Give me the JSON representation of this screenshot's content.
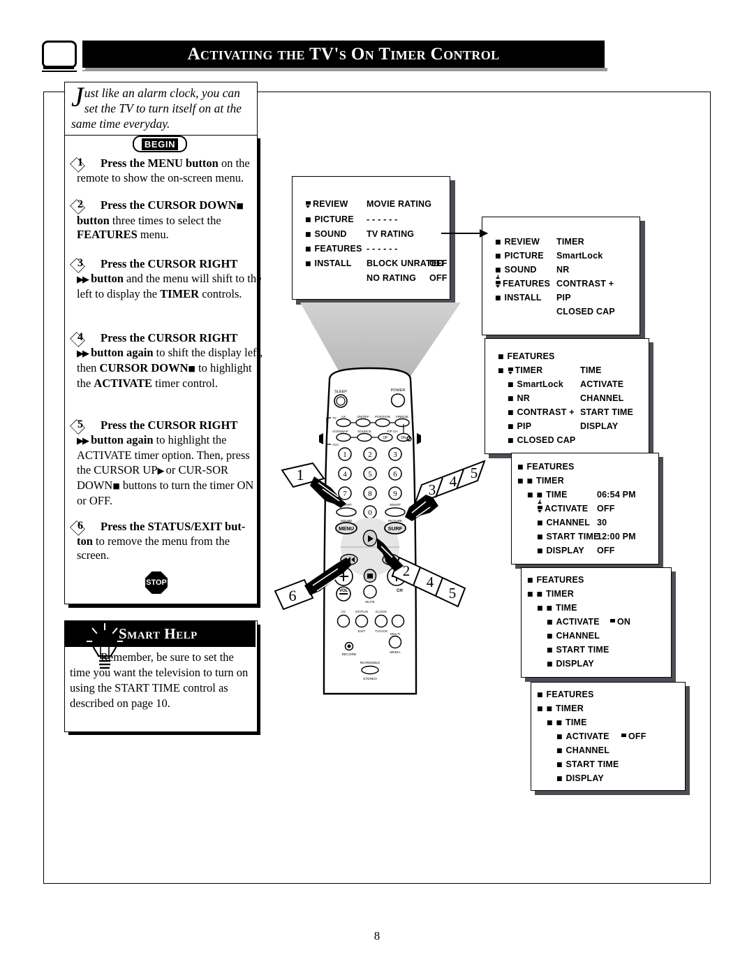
{
  "header": {
    "title": "Activating the TV's On Timer Control",
    "tv_icon": "tv-screen-icon"
  },
  "intro": {
    "dropcap": "J",
    "text": "ust like an alarm clock, you can set the TV to turn itself on at the same time everyday."
  },
  "begin_badge": "BEGIN",
  "stop_badge": "STOP",
  "steps": [
    {
      "number": "1",
      "line1_bold": "Press the MENU button",
      "line1_rest": " on the",
      "rest": "remote to show the on-screen menu."
    },
    {
      "number": "2",
      "line1_bold": "Press the CURSOR DOWN",
      "line1_rest": "",
      "rest_bold": "button",
      "rest": " three times to select the ",
      "rest_bold2": "FEATURES",
      "rest2": " menu."
    },
    {
      "number": "3",
      "line1_bold": "Press the CURSOR RIGHT",
      "rest_bold": "button",
      "rest": " and the menu will shift to the left to display the ",
      "rest_bold2": "TIMER",
      "rest2": " controls."
    },
    {
      "number": "4",
      "line1_bold": "Press the CURSOR RIGHT",
      "rest_bold": "button again",
      "rest": " to shift the display left, then ",
      "rest_bold2": "CURSOR DOWN",
      "rest2": " to highlight the ",
      "rest_bold3": "ACTIVATE",
      "rest3": " timer control."
    },
    {
      "number": "5",
      "line1_bold": "Press the CURSOR RIGHT",
      "rest_bold": "button again",
      "rest": " to highlight the ACTIVATE timer option. Then, press the CURSOR UP",
      "rest2": " or CUR-SOR DOWN",
      "rest3": " buttons to turn the timer ON or OFF."
    },
    {
      "number": "6",
      "line1_bold": "Press the STATUS/EXIT but-",
      "rest_bold": "ton",
      "rest": " to remove the menu from the screen."
    }
  ],
  "smart_help": {
    "title": "Smart Help",
    "icon": "lightbulb-icon",
    "text": "Remember, be sure to set the time you want the television to turn on using the START TIME control as described on page 10."
  },
  "osd_panels": [
    {
      "id": "panel-1-review",
      "left_column": [
        {
          "label": "REVIEW",
          "cursor": "down"
        },
        {
          "label": "PICTURE"
        },
        {
          "label": "SOUND"
        },
        {
          "label": "FEATURES"
        },
        {
          "label": "INSTALL"
        }
      ],
      "right_column": [
        {
          "label": "MOVIE RATING",
          "value": ""
        },
        {
          "label": "- - - - - -",
          "value": ""
        },
        {
          "label": "TV RATING",
          "value": ""
        },
        {
          "label": "- - - - - -",
          "value": ""
        },
        {
          "label": "BLOCK UNRATED",
          "value": "OFF"
        },
        {
          "label": "NO RATING",
          "value": "OFF"
        }
      ]
    },
    {
      "id": "panel-2-features",
      "left_column": [
        {
          "label": "REVIEW"
        },
        {
          "label": "PICTURE"
        },
        {
          "label": "SOUND"
        },
        {
          "label": "FEATURES",
          "cursor": "updown"
        },
        {
          "label": "INSTALL"
        }
      ],
      "right_column": [
        {
          "label": "TIMER"
        },
        {
          "label": "SmartLock"
        },
        {
          "label": "NR"
        },
        {
          "label": "CONTRAST +"
        },
        {
          "label": "PIP"
        },
        {
          "label": "CLOSED CAP"
        }
      ]
    },
    {
      "id": "panel-3-timer",
      "left_column": [
        {
          "label": "FEATURES",
          "indent": 0
        },
        {
          "label": "TIMER",
          "indent": 0,
          "double": true,
          "cursor": "down"
        },
        {
          "label": "SmartLock",
          "indent": 1
        },
        {
          "label": "NR",
          "indent": 1
        },
        {
          "label": "CONTRAST +",
          "indent": 1
        },
        {
          "label": "PIP",
          "indent": 1
        },
        {
          "label": "CLOSED CAP",
          "indent": 1
        }
      ],
      "right_column": [
        {
          "label": ""
        },
        {
          "label": "TIME"
        },
        {
          "label": "ACTIVATE"
        },
        {
          "label": "CHANNEL"
        },
        {
          "label": "START TIME"
        },
        {
          "label": "DISPLAY"
        }
      ]
    },
    {
      "id": "panel-4-activate-off",
      "rows": [
        {
          "label": "FEATURES",
          "indent": 0,
          "value": ""
        },
        {
          "label": "TIMER",
          "indent": 0,
          "double": true,
          "value": ""
        },
        {
          "label": "TIME",
          "indent": 1,
          "double": true,
          "value": "06:54 PM"
        },
        {
          "label": "ACTIVATE",
          "indent": 2,
          "cursor": "updown",
          "value": "OFF"
        },
        {
          "label": "CHANNEL",
          "indent": 2,
          "value": "30"
        },
        {
          "label": "START TIME",
          "indent": 2,
          "value": "12:00 PM"
        },
        {
          "label": "DISPLAY",
          "indent": 2,
          "value": "OFF"
        }
      ]
    },
    {
      "id": "panel-5-activate-on",
      "rows": [
        {
          "label": "FEATURES",
          "indent": 0,
          "value": ""
        },
        {
          "label": "TIMER",
          "indent": 0,
          "double": true,
          "value": ""
        },
        {
          "label": "TIME",
          "indent": 1,
          "double": true,
          "value": ""
        },
        {
          "label": "ACTIVATE",
          "indent": 2,
          "value": "ON",
          "value_cursor": true
        },
        {
          "label": "CHANNEL",
          "indent": 2,
          "value": ""
        },
        {
          "label": "START TIME",
          "indent": 2,
          "value": ""
        },
        {
          "label": "DISPLAY",
          "indent": 2,
          "value": ""
        }
      ]
    },
    {
      "id": "panel-6-activate-off2",
      "rows": [
        {
          "label": "FEATURES",
          "indent": 0,
          "value": ""
        },
        {
          "label": "TIMER",
          "indent": 0,
          "double": true,
          "value": ""
        },
        {
          "label": "TIME",
          "indent": 1,
          "double": true,
          "value": ""
        },
        {
          "label": "ACTIVATE",
          "indent": 2,
          "value": "OFF",
          "value_cursor": true
        },
        {
          "label": "CHANNEL",
          "indent": 2,
          "value": ""
        },
        {
          "label": "START TIME",
          "indent": 2,
          "value": ""
        },
        {
          "label": "DISPLAY",
          "indent": 2,
          "value": ""
        }
      ]
    }
  ],
  "remote": {
    "buttons_top": [
      "SLEEP",
      "POWER"
    ],
    "side_labels": [
      "TV",
      "VCR",
      "ACC"
    ],
    "row1": [
      "AX",
      "ON/OFF",
      "POSITION",
      "FREEZE"
    ],
    "row2": [
      "SWAP",
      "SOURCE",
      "PIP CH"
    ],
    "row2_small": [
      "UP",
      "DN"
    ],
    "keypad": [
      "1",
      "2",
      "3",
      "4",
      "5",
      "6",
      "7",
      "8",
      "9",
      "0"
    ],
    "smart_sound": "SMART",
    "smart_sound_sub": "SOUND",
    "smart_picture": "SMART",
    "smart_picture_sub": "PICTURE",
    "menu": "MENU",
    "surf": "SURF",
    "vol": "VOL",
    "ch": "CH",
    "mute": "MUTE",
    "cc": "CC",
    "status": "STATUS",
    "status_sub": "EXIT",
    "clock": "CLOCK",
    "clock_sub": "TV/VCR",
    "record": "RECORD",
    "multi": "MULTI",
    "multi_sub": "MEDIA",
    "incredible": "INCREDIBLE",
    "incredible_sub": "STEREO"
  },
  "callouts": [
    {
      "id": "callout-1",
      "labels": [
        "1"
      ]
    },
    {
      "id": "callout-345",
      "labels": [
        "3",
        "4",
        "5"
      ]
    },
    {
      "id": "callout-245",
      "labels": [
        "2",
        "4",
        "5"
      ]
    },
    {
      "id": "callout-6",
      "labels": [
        "6"
      ]
    }
  ],
  "page_number": "8"
}
